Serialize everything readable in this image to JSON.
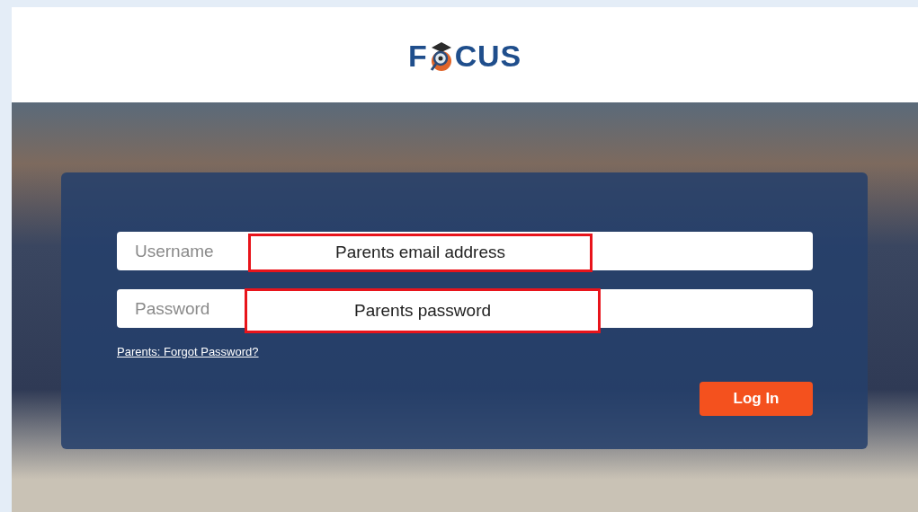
{
  "logo": {
    "before": "F",
    "after": "CUS"
  },
  "fields": [
    {
      "placeholder": "Username",
      "annotation": "Parents email address"
    },
    {
      "placeholder": "Password",
      "annotation": "Parents password"
    }
  ],
  "forgot_link": "Parents: Forgot Password?",
  "login_button": "Log In"
}
